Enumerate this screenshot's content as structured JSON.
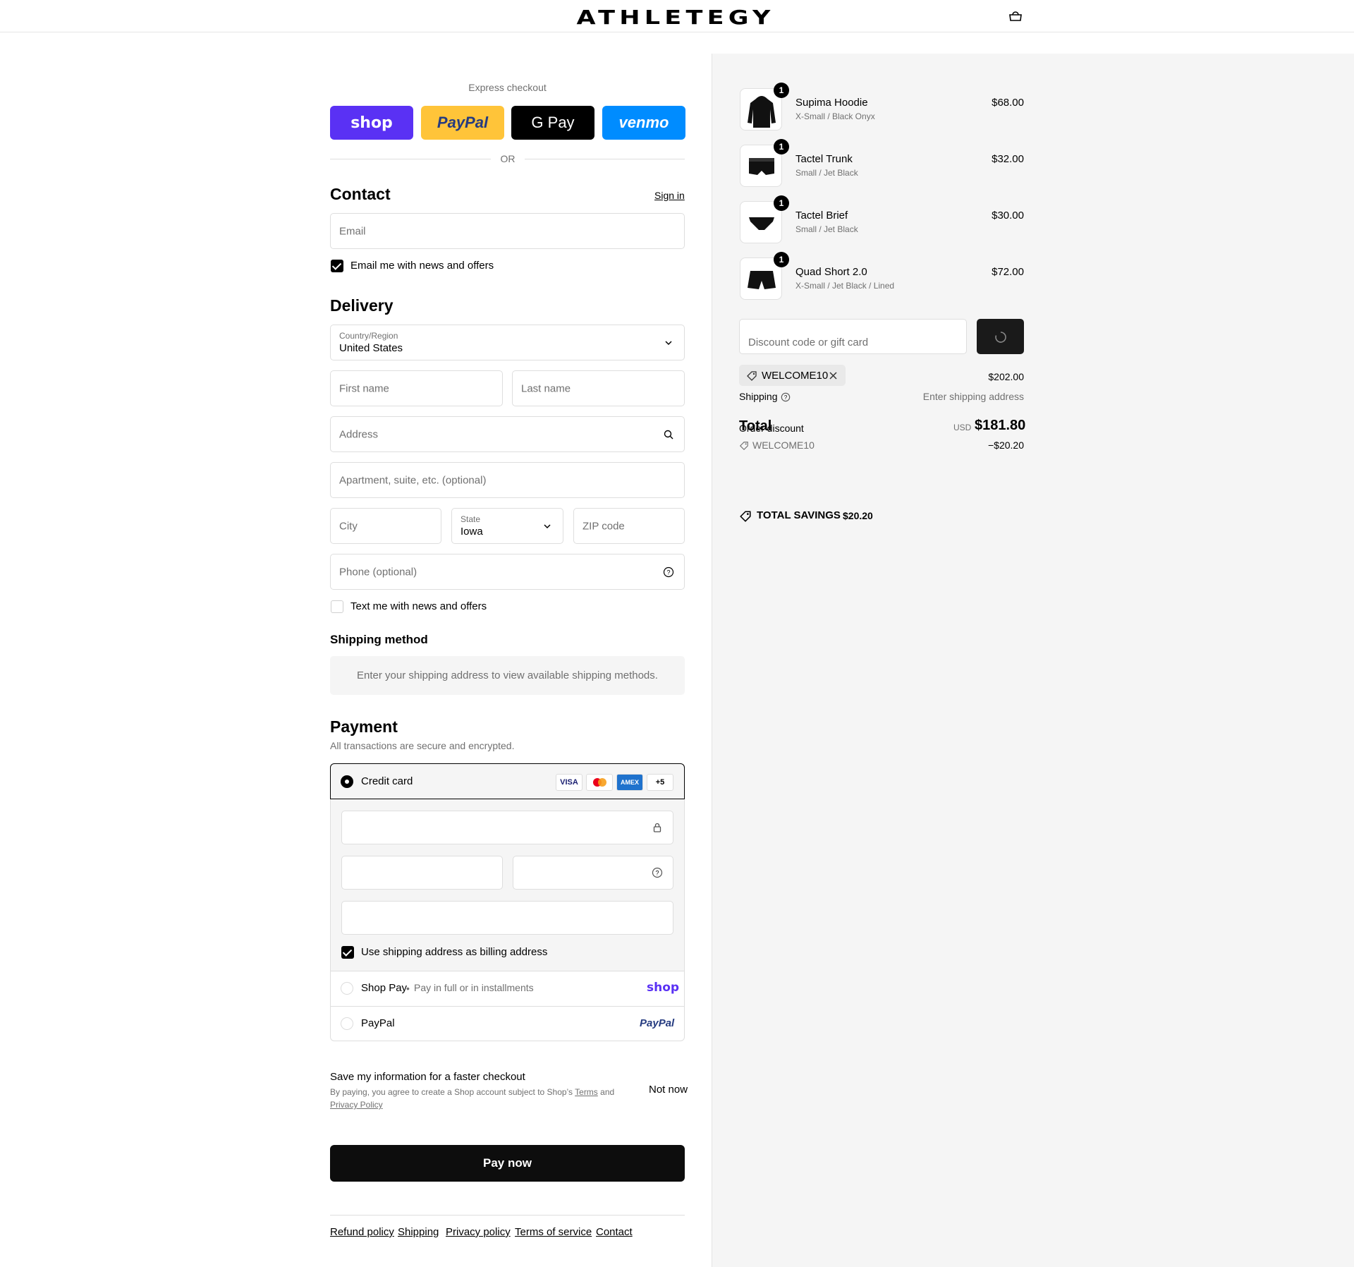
{
  "header": {
    "brand": "ATHLETEGY",
    "cart_icon": "bag-icon"
  },
  "express": {
    "title": "Express checkout",
    "buttons": [
      "shop",
      "PayPal",
      "G Pay",
      "venmo"
    ],
    "or": "OR"
  },
  "contact": {
    "title": "Contact",
    "sign_in": "Sign in",
    "email_placeholder": "Email",
    "newsletter_label": "Email me with news and offers",
    "newsletter_checked": true
  },
  "delivery": {
    "title": "Delivery",
    "country_label": "Country/Region",
    "country_value": "United States",
    "first_name": "First name",
    "last_name": "Last name",
    "address": "Address",
    "apartment": "Apartment, suite, etc. (optional)",
    "city": "City",
    "state_label": "State",
    "state_value": "Iowa",
    "zip": "ZIP code",
    "phone": "Phone (optional)",
    "text_label": "Text me with news and offers",
    "text_checked": false
  },
  "shipping_method": {
    "title": "Shipping method",
    "notice": "Enter your shipping address to view available shipping methods."
  },
  "payment": {
    "title": "Payment",
    "subtitle": "All transactions are secure and encrypted.",
    "credit_card_label": "Credit card",
    "card_brands": [
      "VISA",
      "MC",
      "AMEX",
      "+5"
    ],
    "billing_label": "Use shipping address as billing address",
    "billing_checked": true,
    "shop_pay_label": "Shop Pay",
    "shop_pay_sub": "Pay in full or in installments",
    "shop_pay_logo": "shop",
    "paypal_label": "PayPal",
    "paypal_logo": "PayPal"
  },
  "save_info": {
    "title": "Save my information for a faster checkout",
    "terms_prefix": "By paying, you agree to create a Shop account subject to Shop’s",
    "terms_link": "Terms",
    "and": "and",
    "privacy_link": "Privacy Policy",
    "not_now": "Not now"
  },
  "pay_button": "Pay now",
  "footer": [
    "Refund policy",
    "Shipping",
    "Privacy policy",
    "Terms of service",
    "Contact"
  ],
  "cart": {
    "items": [
      {
        "name": "Supima Hoodie",
        "variant": "X-Small / Black Onyx",
        "price": "$68.00",
        "qty": "1",
        "icon": "hoodie-icon"
      },
      {
        "name": "Tactel Trunk",
        "variant": "Small / Jet Black",
        "price": "$32.00",
        "qty": "1",
        "icon": "trunk-icon"
      },
      {
        "name": "Tactel Brief",
        "variant": "Small / Jet Black",
        "price": "$30.00",
        "qty": "1",
        "icon": "brief-icon"
      },
      {
        "name": "Quad Short 2.0",
        "variant": "X-Small / Jet Black / Lined",
        "price": "$72.00",
        "qty": "1",
        "icon": "shorts-icon"
      }
    ],
    "discount_placeholder": "Discount code or gift card",
    "code_tag": "WELCOME10",
    "subtotal": "$202.00",
    "shipping_label": "Shipping",
    "shipping_value": "Enter shipping address",
    "order_discount_label": "Order discount",
    "discount_code": "WELCOME10",
    "discount_amount": "−$20.20",
    "total_label": "Total",
    "currency": "USD",
    "total": "$181.80",
    "savings_label": "TOTAL SAVINGS",
    "savings_value": "$20.20"
  },
  "colors": {
    "shop": "#5a31f4",
    "paypal": "#ffc439",
    "gpay": "#000000",
    "venmo": "#008cff"
  }
}
